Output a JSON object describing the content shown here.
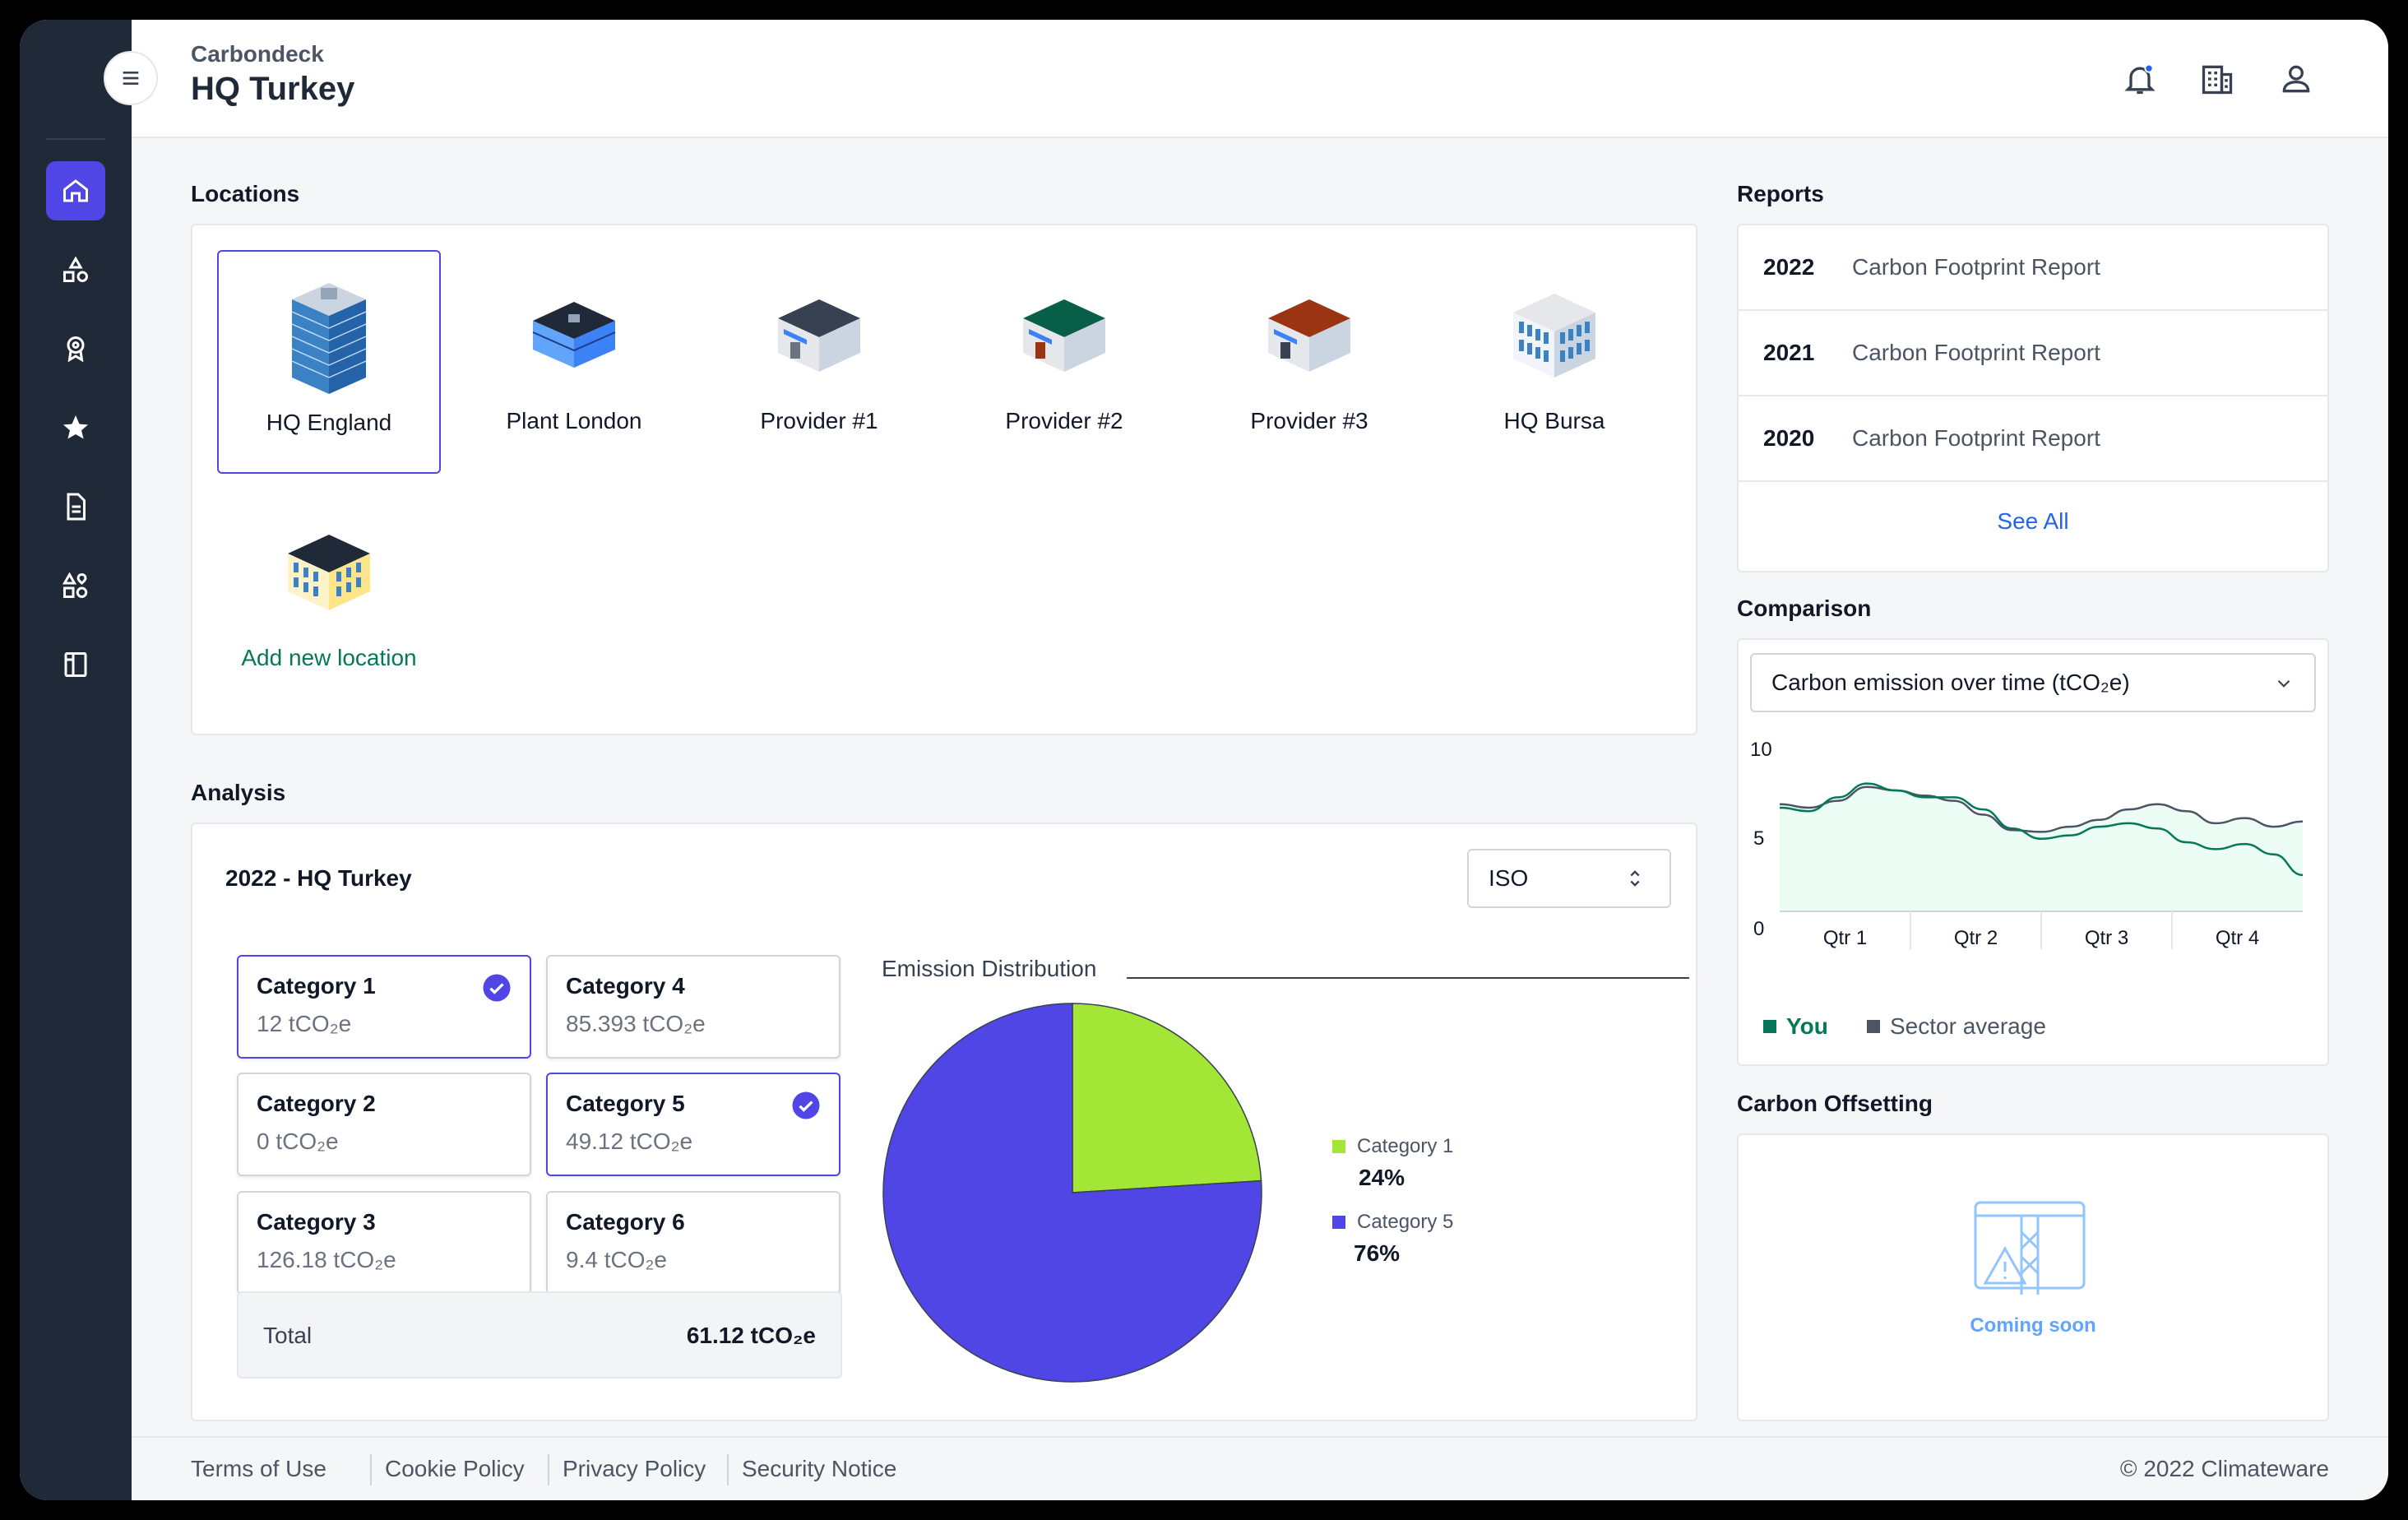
{
  "header": {
    "brand": "Carbondeck",
    "title": "HQ Turkey"
  },
  "locations": {
    "title": "Locations",
    "items": [
      {
        "label": "HQ England",
        "icon": "office-tower-building-icon",
        "selected": true
      },
      {
        "label": "Plant London",
        "icon": "factory-building-icon"
      },
      {
        "label": "Provider #1",
        "icon": "warehouse-dark-roof-icon"
      },
      {
        "label": "Provider #2",
        "icon": "warehouse-green-roof-icon"
      },
      {
        "label": "Provider #3",
        "icon": "warehouse-brown-roof-icon"
      },
      {
        "label": "HQ Bursa",
        "icon": "office-building-icon"
      }
    ],
    "add_label": "Add new location"
  },
  "reports": {
    "title": "Reports",
    "items": [
      {
        "year": "2022",
        "name": "Carbon Footprint Report"
      },
      {
        "year": "2021",
        "name": "Carbon Footprint Report"
      },
      {
        "year": "2020",
        "name": "Carbon Footprint Report"
      }
    ],
    "see_all": "See All"
  },
  "comparison": {
    "title": "Comparison",
    "select_value": "Carbon emission over time (tCO₂e)",
    "legend_you": "You",
    "legend_sector": "Sector average"
  },
  "offsetting": {
    "title": "Carbon Offsetting",
    "coming_soon": "Coming soon"
  },
  "analysis": {
    "title": "Analysis",
    "subtitle": "2022 - HQ Turkey",
    "standard": "ISO",
    "categories": [
      {
        "name": "Category 1",
        "value": "12 tCO₂e",
        "selected": true
      },
      {
        "name": "Category 2",
        "value": "0 tCO₂e",
        "selected": false
      },
      {
        "name": "Category 3",
        "value": "126.18 tCO₂e",
        "selected": false
      },
      {
        "name": "Category 4",
        "value": "85.393 tCO₂e",
        "selected": false
      },
      {
        "name": "Category 5",
        "value": "49.12 tCO₂e",
        "selected": true
      },
      {
        "name": "Category 6",
        "value": "9.4 tCO₂e",
        "selected": false
      }
    ],
    "total_label": "Total",
    "total_value": "61.12 tCO₂e",
    "distribution_title": "Emission Distribution"
  },
  "chart_data": [
    {
      "type": "pie",
      "title": "Emission Distribution",
      "labels": [
        "Category 1",
        "Category 5"
      ],
      "values": [
        24,
        76
      ],
      "display": [
        "24%",
        "76%"
      ],
      "colors": [
        "#a3e635",
        "#4f46e5"
      ]
    },
    {
      "type": "area",
      "x": [
        "Qtr 1",
        "Qtr 2",
        "Qtr 3",
        "Qtr 4"
      ],
      "ylim": [
        0,
        10
      ],
      "yticks": [
        "10",
        "5",
        "0"
      ],
      "series": [
        {
          "name": "You",
          "color": "#047857",
          "values": [
            6.0,
            5.8,
            6.6,
            7.4,
            7.0,
            6.6,
            6.6,
            5.9,
            4.8,
            4.2,
            4.4,
            4.9,
            5.1,
            4.8,
            4.0,
            3.6,
            3.9,
            3.3,
            2.1
          ]
        },
        {
          "name": "Sector average",
          "color": "#4b5563",
          "values": [
            6.2,
            6.0,
            6.4,
            7.2,
            7.0,
            6.7,
            6.4,
            5.6,
            4.7,
            4.6,
            4.9,
            5.3,
            5.9,
            6.2,
            5.8,
            5.1,
            5.4,
            4.9,
            5.2
          ]
        }
      ]
    }
  ],
  "footer": {
    "links": [
      "Terms of Use",
      "Cookie Policy",
      "Privacy Policy",
      "Security Notice"
    ],
    "copyright": "© 2022 Climateware"
  },
  "colors": {
    "accent": "#4f46e5",
    "sidebar": "#1f2937",
    "green": "#047857",
    "link": "#2563eb"
  }
}
